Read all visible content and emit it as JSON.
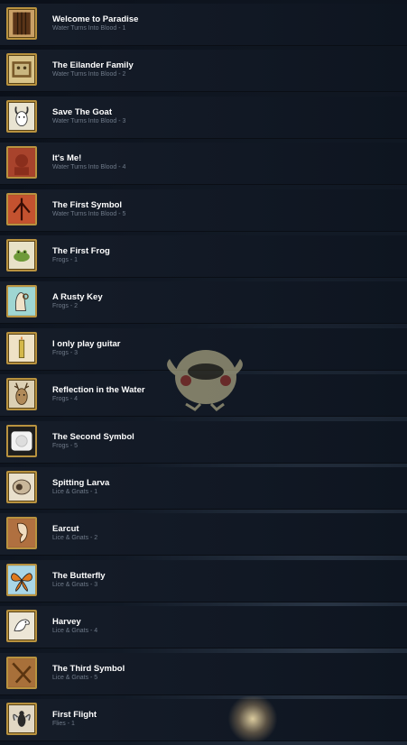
{
  "achievements": [
    {
      "title": "Welcome to Paradise",
      "subtitle": "Water Turns Into Blood - 1",
      "icon": "wooden-door-icon",
      "bg": "#c9a066"
    },
    {
      "title": "The Eilander Family",
      "subtitle": "Water Turns Into Blood - 2",
      "icon": "family-portrait-icon",
      "bg": "#d9c48a"
    },
    {
      "title": "Save The Goat",
      "subtitle": "Water Turns Into Blood - 3",
      "icon": "goat-icon",
      "bg": "#e9e4d2"
    },
    {
      "title": "It's Me!",
      "subtitle": "Water Turns Into Blood - 4",
      "icon": "portrait-icon",
      "bg": "#a8432c"
    },
    {
      "title": "The First Symbol",
      "subtitle": "Water Turns Into Blood - 5",
      "icon": "blood-symbol-icon",
      "bg": "#c4522f"
    },
    {
      "title": "The First Frog",
      "subtitle": "Frogs - 1",
      "icon": "frog-icon",
      "bg": "#e8e2c8"
    },
    {
      "title": "A Rusty Key",
      "subtitle": "Frogs - 2",
      "icon": "hand-with-key-icon",
      "bg": "#9fd6d2"
    },
    {
      "title": "I only play guitar",
      "subtitle": "Frogs - 3",
      "icon": "candle-icon",
      "bg": "#efe2c6"
    },
    {
      "title": "Reflection in the Water",
      "subtitle": "Frogs - 4",
      "icon": "deer-icon",
      "bg": "#dcd0b4"
    },
    {
      "title": "The Second Symbol",
      "subtitle": "Frogs - 5",
      "icon": "frog-symbol-icon",
      "bg": "#1e1e1e"
    },
    {
      "title": "Spitting Larva",
      "subtitle": "Lice & Gnats - 1",
      "icon": "larva-icon",
      "bg": "#e9e0cc"
    },
    {
      "title": "Earcut",
      "subtitle": "Lice & Gnats - 2",
      "icon": "ear-icon",
      "bg": "#b07040"
    },
    {
      "title": "The Butterfly",
      "subtitle": "Lice & Gnats - 3",
      "icon": "butterfly-icon",
      "bg": "#a9d6e6"
    },
    {
      "title": "Harvey",
      "subtitle": "Lice & Gnats - 4",
      "icon": "bird-icon",
      "bg": "#ece6d6"
    },
    {
      "title": "The Third Symbol",
      "subtitle": "Lice & Gnats - 5",
      "icon": "wood-symbol-icon",
      "bg": "#a8703a"
    },
    {
      "title": "First Flight",
      "subtitle": "Flies - 1",
      "icon": "fly-icon",
      "bg": "#e2d8c4"
    }
  ]
}
